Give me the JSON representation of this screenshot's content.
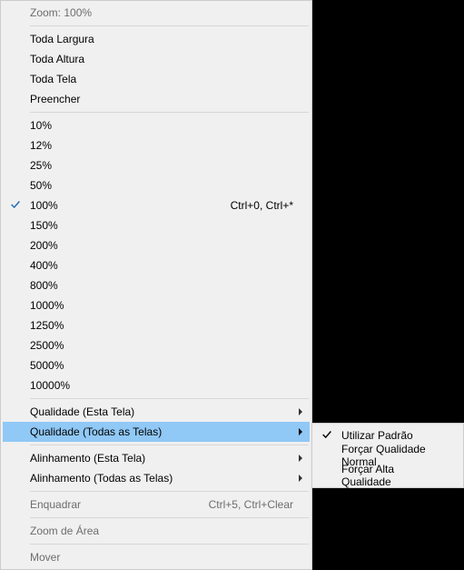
{
  "main_menu": {
    "header": "Zoom: 100%",
    "fit_items": [
      {
        "label": "Toda Largura"
      },
      {
        "label": "Toda Altura"
      },
      {
        "label": "Toda Tela"
      },
      {
        "label": "Preencher"
      }
    ],
    "zoom_items": [
      {
        "label": "10%"
      },
      {
        "label": "12%"
      },
      {
        "label": "25%"
      },
      {
        "label": "50%"
      },
      {
        "label": "100%",
        "shortcut": "Ctrl+0, Ctrl+*",
        "checked": true
      },
      {
        "label": "150%"
      },
      {
        "label": "200%"
      },
      {
        "label": "400%"
      },
      {
        "label": "800%"
      },
      {
        "label": "1000%"
      },
      {
        "label": "1250%"
      },
      {
        "label": "2500%"
      },
      {
        "label": "5000%"
      },
      {
        "label": "10000%"
      }
    ],
    "quality_items": [
      {
        "label": "Qualidade (Esta Tela)",
        "submenu": true
      },
      {
        "label": "Qualidade (Todas as Telas)",
        "submenu": true,
        "highlighted": true
      }
    ],
    "align_items": [
      {
        "label": "Alinhamento (Esta Tela)",
        "submenu": true
      },
      {
        "label": "Alinhamento (Todas as Telas)",
        "submenu": true
      }
    ],
    "bottom_items": [
      {
        "label": "Enquadrar",
        "shortcut": "Ctrl+5, Ctrl+Clear",
        "disabled": true
      },
      {
        "label": "Zoom de Área",
        "disabled": true
      },
      {
        "label": "Mover",
        "disabled": true
      }
    ]
  },
  "sub_menu": {
    "items": [
      {
        "label": "Utilizar Padrão",
        "checked": true
      },
      {
        "label": "Forçar Qualidade Normal"
      },
      {
        "label": "Forçar Alta Qualidade"
      }
    ]
  }
}
